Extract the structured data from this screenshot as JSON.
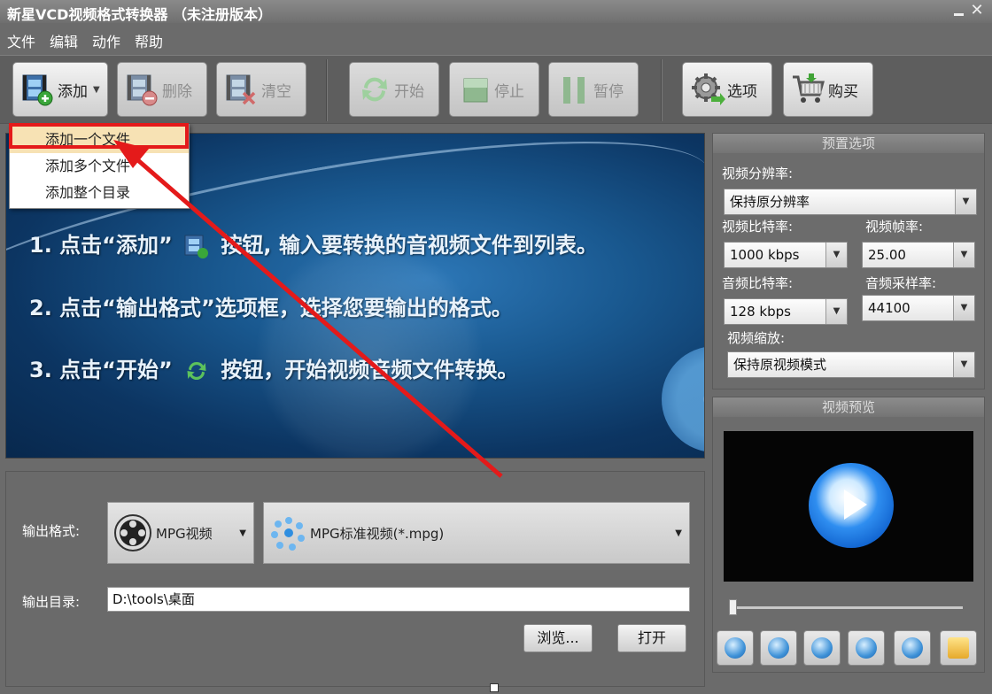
{
  "window": {
    "title": "新星VCD视频格式转换器 （未注册版本）",
    "close_glyph": "✕"
  },
  "menu": [
    {
      "label": "文件"
    },
    {
      "label": "编辑"
    },
    {
      "label": "动作"
    },
    {
      "label": "帮助"
    }
  ],
  "toolbar": {
    "add": "添加",
    "delete": "删除",
    "clear": "清空",
    "start": "开始",
    "stop": "停止",
    "pause": "暂停",
    "options": "选项",
    "buy": "购买"
  },
  "add_menu": {
    "items": [
      "添加一个文件",
      "添加多个文件",
      "添加整个目录"
    ]
  },
  "instructions": {
    "step1_a": "1. 点击“添加”",
    "step1_b": "按钮, 输入要转换的音视频文件到列表。",
    "step2": "2. 点击“输出格式”选项框，选择您要输出的格式。",
    "step3_a": "3. 点击“开始”",
    "step3_b": "按钮，开始视频音频文件转换。"
  },
  "output": {
    "format_label": "输出格式:",
    "format_value": "MPG视频",
    "subformat_value": "MPG标准视频(*.mpg)",
    "dir_label": "输出目录:",
    "dir_value": "D:\\tools\\桌面",
    "browse_label": "浏览...",
    "open_label": "打开"
  },
  "preset": {
    "header": "预置选项",
    "resolution_label": "视频分辨率:",
    "resolution_value": "保持原分辨率",
    "video_bitrate_label": "视频比特率:",
    "video_bitrate_value": "1000 kbps",
    "framerate_label": "视频帧率:",
    "framerate_value": "25.00",
    "audio_bitrate_label": "音频比特率:",
    "audio_bitrate_value": "128 kbps",
    "samplerate_label": "音频采样率:",
    "samplerate_value": "44100",
    "scale_label": "视频缩放:",
    "scale_value": "保持原视频模式"
  },
  "preview": {
    "header": "视频预览"
  },
  "colors": {
    "highlight_red": "#e41a1a",
    "active_item_bg": "#f7e2b4",
    "banner_blue": "#19588f"
  }
}
